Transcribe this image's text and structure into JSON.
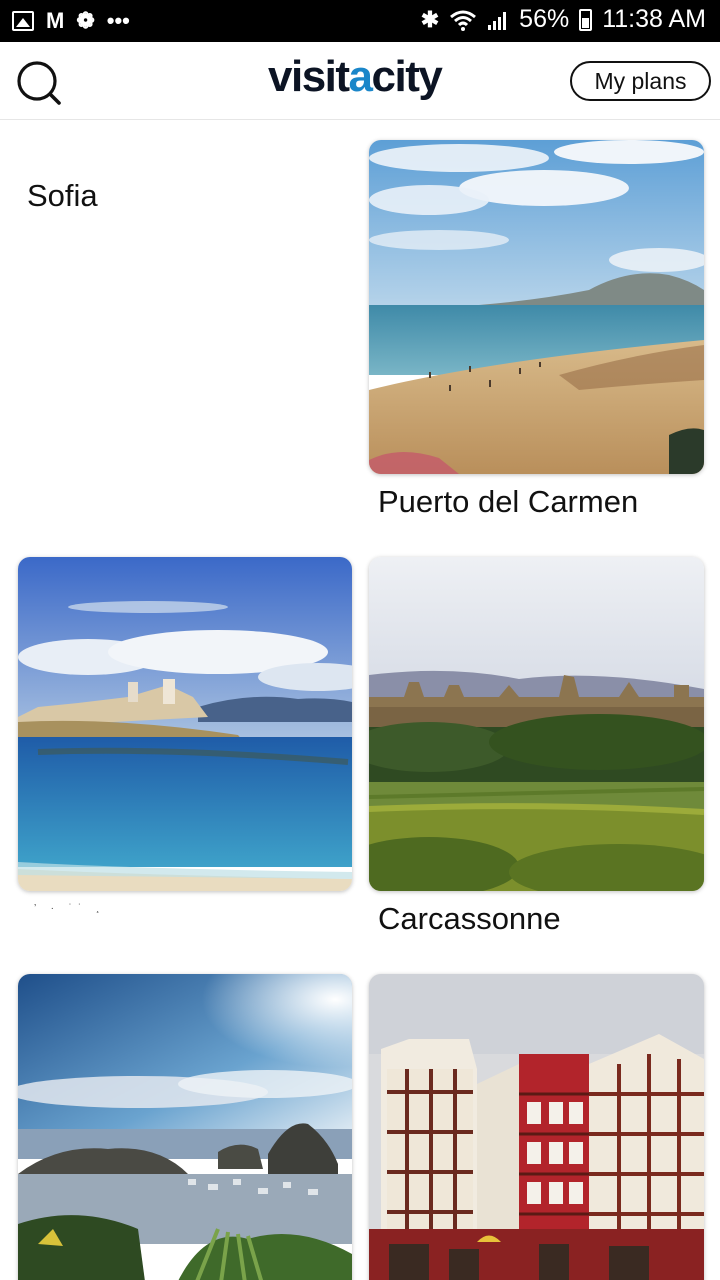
{
  "status_bar": {
    "battery": "56%",
    "time": "11:38 AM",
    "overflow": "•••",
    "icons": [
      "gallery-icon",
      "gmail-icon",
      "pinwheel-icon",
      "bluetooth-icon",
      "wifi-icon",
      "signal-icon",
      "battery-icon"
    ]
  },
  "header": {
    "logo_part1": "visit",
    "logo_accent": "a",
    "logo_part2": "city",
    "my_plans": "My plans",
    "accent_color": "#1a86c9"
  },
  "cities": [
    {
      "name": "Sofia"
    },
    {
      "name": "Puerto del Carmen"
    },
    {
      "name": "’ · ˙˙ ¸"
    },
    {
      "name": "Carcassonne"
    },
    {
      "name": ""
    },
    {
      "name": ""
    }
  ]
}
